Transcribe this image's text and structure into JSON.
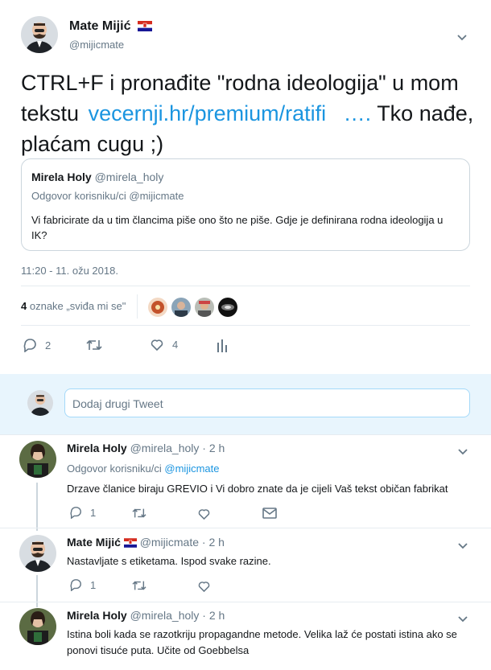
{
  "main_tweet": {
    "author_name": "Mate Mijić",
    "flag": "🇭🇷",
    "handle": "@mijicmate",
    "text_before_link": "CTRL+F i pronađite \"rodna ideologija\" u mom tekstu",
    "link_text": "vecernji.hr/premium/ratifi",
    "link_ellipsis": "….",
    "text_after_link": "Tko nađe, plaćam cugu ;)",
    "timestamp": "11:20 - 11. ožu 2018.",
    "likes_count_bold": "4",
    "likes_label": "oznake „sviđa mi se\"",
    "reply_count": "2",
    "like_count": "4"
  },
  "quoted_tweet": {
    "author_name": "Mirela Holy",
    "handle": "@mirela_holy",
    "reply_to": "Odgovor korisniku/ci @mijicmate",
    "text": "Vi fabricirate da u tim člancima piše ono što ne piše. Gdje je definirana rodna ideologija u IK?"
  },
  "compose": {
    "placeholder": "Dodaj drugi Tweet"
  },
  "replies": [
    {
      "author_name": "Mirela Holy",
      "handle": "@mirela_holy",
      "time": "· 2 h",
      "reply_to_prefix": "Odgovor korisniku/ci",
      "reply_to_handle": "@mijicmate",
      "text": "Drzave članice biraju GREVIO i Vi dobro znate da je cijeli Vaš tekst običan fabrikat",
      "reply_count": "1"
    },
    {
      "author_name": "Mate Mijić",
      "flag": "🇭🇷",
      "handle": "@mijicmate",
      "time": "· 2 h",
      "text": "Nastavljate s etiketama. Ispod svake razine.",
      "reply_count": "1"
    },
    {
      "author_name": "Mirela Holy",
      "handle": "@mirela_holy",
      "time": "· 2 h",
      "text": "Istina boli kada se razotkriju propagandne metode. Velika laž će postati istina ako se ponovi tisuće puta. Učite od Goebbelsa"
    }
  ],
  "colors": {
    "link": "#1b95e0",
    "muted": "#657786",
    "thread_line": "#ccd6dd"
  }
}
